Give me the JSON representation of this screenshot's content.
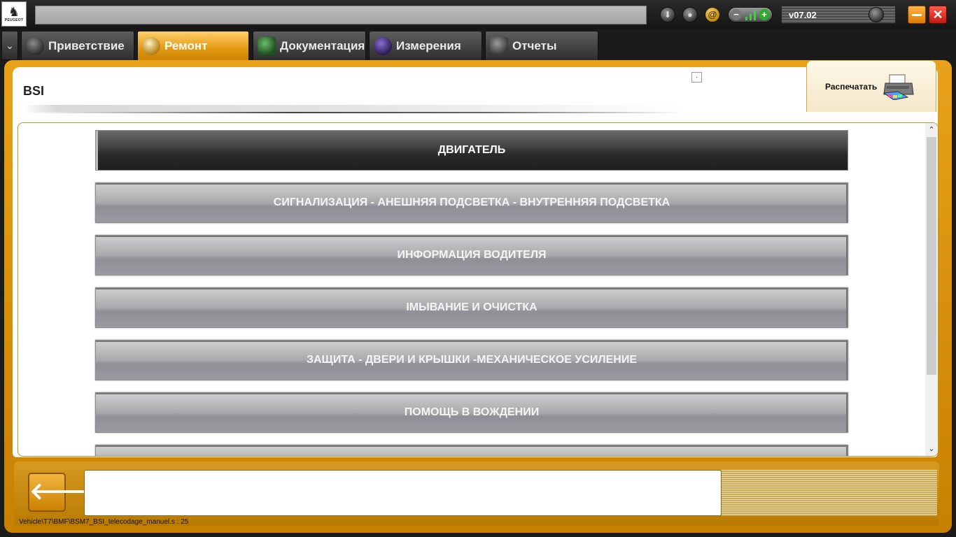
{
  "titlebar": {
    "logo_brand": "PEUGEOT",
    "address_value": "",
    "version": "v07.02"
  },
  "tabs": [
    {
      "label": "Приветствие"
    },
    {
      "label": "Ремонт"
    },
    {
      "label": "Документация"
    },
    {
      "label": "Измерения"
    },
    {
      "label": "Отчеты"
    }
  ],
  "active_tab": "Ремонт",
  "page": {
    "breadcrumb": "BSI",
    "print_label": "Распечатать"
  },
  "categories": [
    "ДВИГАТЕЛЬ",
    "СИГНАЛИЗАЦИЯ - АНЕШНЯЯ ПОДСВЕТКА - ВНУТРЕННЯЯ ПОДСВЕТКА",
    "ИНФОРМАЦИЯ ВОДИТЕЛЯ",
    "IМЫВАНИЕ И ОЧИСТКА",
    "ЗАЩИТА - ДВЕРИ И КРЫШКИ -МЕХАНИЧЕСКОЕ УСИЛЕНИЕ",
    "ПОМОЩЬ В ВОЖДЕНИИ",
    ""
  ],
  "selected_category": "ДВИГАТЕЛЬ",
  "footer": {
    "message": "",
    "status_path": "Vehicle\\T7\\BMF\\BSM7_BSI_telecodage_manuel.s : 25"
  },
  "colors": {
    "accent": "#e39a12",
    "active_item": "#2a2a2a",
    "close": "#d0261a",
    "minimize": "#f0961f"
  },
  "icons": [
    "peugeot-logo",
    "download-icon",
    "user-icon",
    "email-icon",
    "zoom-out-icon",
    "zoom-in-icon",
    "minimize-icon",
    "close-icon",
    "printer-icon",
    "back-arrow-icon"
  ]
}
